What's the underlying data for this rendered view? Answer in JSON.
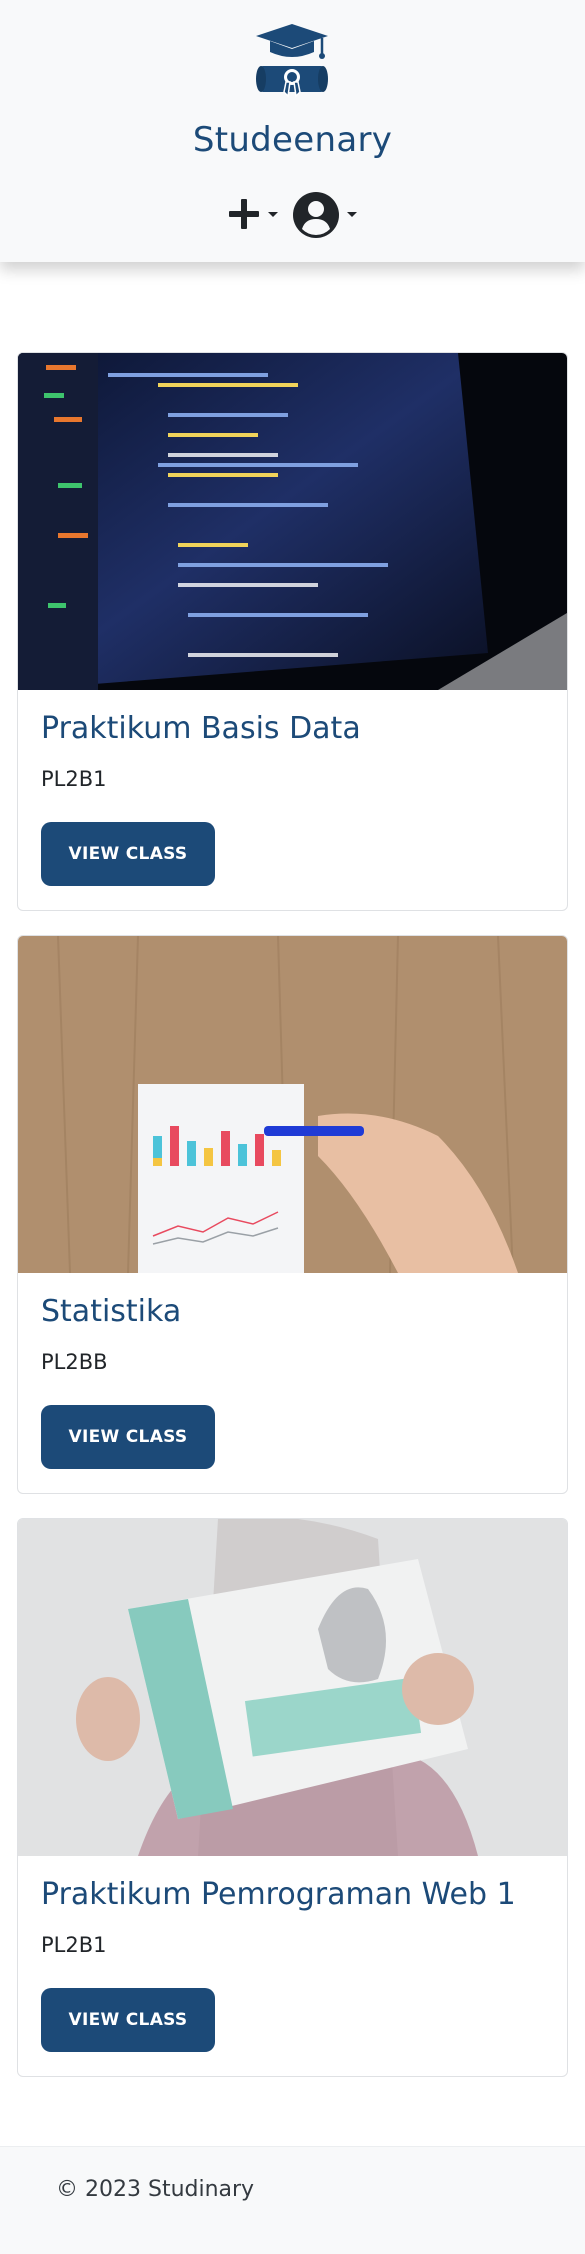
{
  "header": {
    "brand": "Studeenary",
    "logo_icon": "graduation-cap-diploma-icon",
    "add_icon": "plus-icon",
    "user_icon": "user-circle-icon",
    "brand_color": "#1c4a78"
  },
  "classes": [
    {
      "title": "Praktikum Basis Data",
      "code": "PL2B1",
      "button": "VIEW CLASS",
      "image": "code-on-laptop-screen"
    },
    {
      "title": "Statistika",
      "code": "PL2BB",
      "button": "VIEW CLASS",
      "image": "bar-chart-paper-on-wood"
    },
    {
      "title": "Praktikum Pemrograman Web 1",
      "code": "PL2B1",
      "button": "VIEW CLASS",
      "image": "dynamic-html-book"
    }
  ],
  "footer": {
    "text": "© 2023 Studinary"
  }
}
